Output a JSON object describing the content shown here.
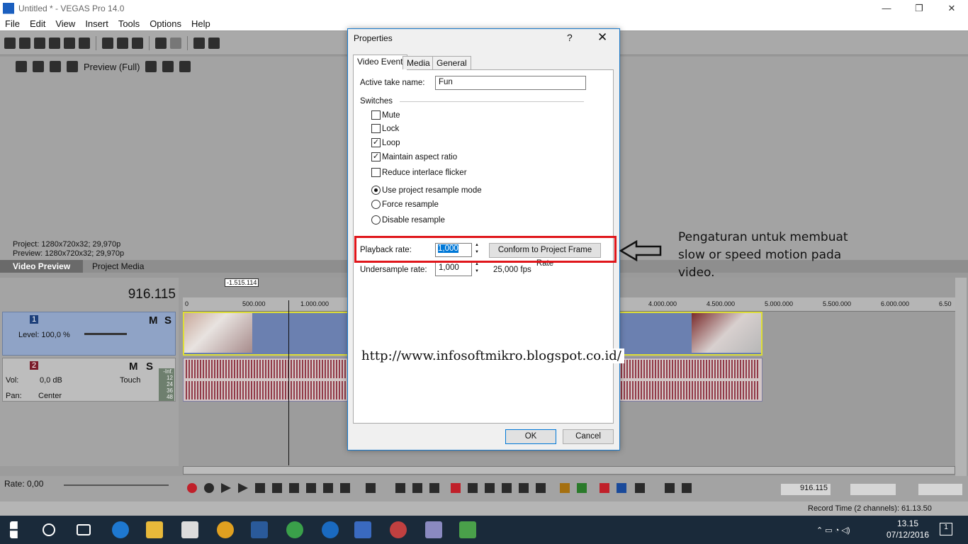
{
  "window": {
    "title": "Untitled * - VEGAS Pro 14.0"
  },
  "menu": [
    "File",
    "Edit",
    "View",
    "Insert",
    "Tools",
    "Options",
    "Help"
  ],
  "preview": {
    "mode_label": "Preview (Full)",
    "project_line": "Project:   1280x720x32; 29,970p",
    "preview_line": "Preview:  1280x720x32; 29,970p",
    "tabs": [
      "Video Preview",
      "Project Media"
    ]
  },
  "timeline": {
    "timecode": "916.115",
    "region_label": "-1.515.114",
    "ruler": [
      "0",
      "500.000",
      "1.000.000",
      "4.000.000",
      "4.500.000",
      "5.000.000",
      "5.500.000",
      "6.000.000",
      "6.50"
    ],
    "video_track": {
      "number": "1",
      "level": "Level: 100,0 %",
      "mute": "M",
      "solo": "S"
    },
    "audio_track": {
      "number": "2",
      "vol_label": "Vol:",
      "vol_value": "0,0 dB",
      "pan_label": "Pan:",
      "pan_value": "Center",
      "mode": "Touch",
      "mute": "M",
      "solo": "S",
      "meter": [
        "-Inf.",
        "12",
        "24",
        "36",
        "48"
      ]
    }
  },
  "transport": {
    "rate": "Rate: 0,00",
    "timecode": "916.115"
  },
  "status": {
    "record_time": "Record Time (2 channels): 61.13.50"
  },
  "taskbar": {
    "time": "13.15",
    "date": "07/12/2016",
    "notifications": "1"
  },
  "dialog": {
    "title": "Properties",
    "help": "?",
    "close": "✕",
    "tabs": [
      "Video Event",
      "Media",
      "General"
    ],
    "active_take_label": "Active take name:",
    "active_take_value": "Fun",
    "switches_label": "Switches",
    "checkboxes": [
      {
        "label": "Mute",
        "checked": false
      },
      {
        "label": "Lock",
        "checked": false
      },
      {
        "label": "Loop",
        "checked": true
      },
      {
        "label": "Maintain aspect ratio",
        "checked": true
      },
      {
        "label": "Reduce interlace flicker",
        "checked": false
      }
    ],
    "radios": [
      {
        "label": "Use project resample mode",
        "selected": true
      },
      {
        "label": "Force resample",
        "selected": false
      },
      {
        "label": "Disable resample",
        "selected": false
      }
    ],
    "playback_rate_label": "Playback rate:",
    "playback_rate_value": "1,000",
    "conform_button": "Conform to Project Frame Rate",
    "undersample_label": "Undersample rate:",
    "undersample_value": "1,000",
    "fps_text": "25,000 fps",
    "ok": "OK",
    "cancel": "Cancel"
  },
  "annotation": {
    "note": "Pengaturan untuk membuat slow or speed motion pada video.",
    "url": "http://www.infosoftmikro.blogspot.co.id/",
    "highlight_color": "#e0161b"
  }
}
